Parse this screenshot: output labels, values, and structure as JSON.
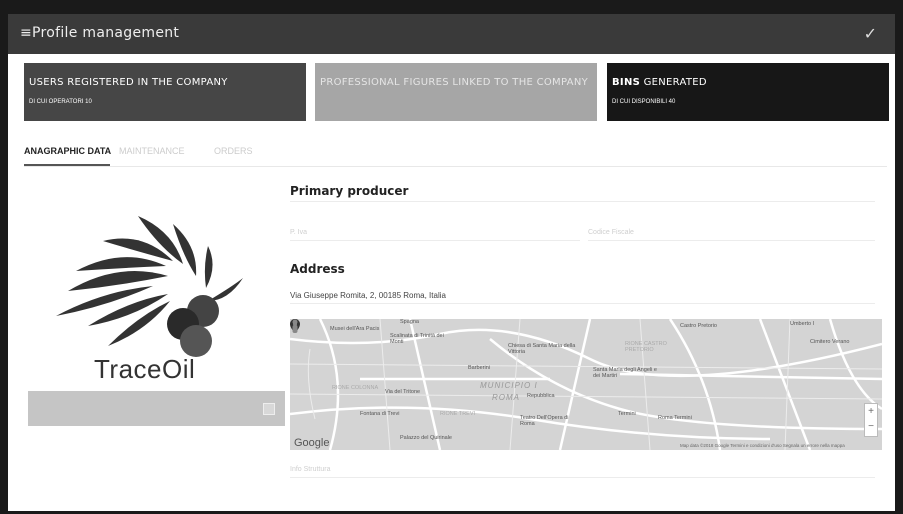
{
  "header": {
    "menu_icon": "≡",
    "title": "Profile management",
    "confirm_icon": "✓"
  },
  "cards": [
    {
      "title": "USERS REGISTERED IN THE COMPANY",
      "subtitle": "DI CUI OPERATORI 10"
    },
    {
      "title": "PROFESSIONAL FIGURES LINKED TO THE COMPANY",
      "subtitle": ""
    },
    {
      "title_bold": "BINS",
      "title_rest": " GENERATED",
      "subtitle": "DI CUI DISPONIBILI 40"
    }
  ],
  "tabs": [
    {
      "label": "ANAGRAPHIC DATA",
      "active": true
    },
    {
      "label": "MAINTENANCE",
      "active": false
    },
    {
      "label": "ORDERS",
      "active": false
    }
  ],
  "logo": {
    "text": "TraceOil"
  },
  "primary_producer": {
    "heading": "Primary producer",
    "vat_placeholder": "P. Iva",
    "fiscal_code_placeholder": "Codice Fiscale"
  },
  "address": {
    "heading": "Address",
    "value": "Via Giuseppe Romita, 2, 00185 Roma, Italia"
  },
  "map": {
    "labels": [
      "Musei dell'Ara Pacis",
      "Spagna",
      "Scalinata di Trinità dei Monti",
      "Chiesa di Santa Maria della Vittoria",
      "Castro Pretorio",
      "Santa Maria degli Angeli e dei Martiri",
      "Barberini",
      "Via del Tritone",
      "Repubblica",
      "Fontana di Trevi",
      "Teatro Dell'Opera di Roma",
      "Termini",
      "Roma Termini",
      "Palazzo del Quirinale",
      "Cimitero Verano",
      "Umberto I"
    ],
    "district_labels": [
      "MUNICIPIO I",
      "ROMA",
      "RIONE COLONNA",
      "RIONE TREVI",
      "RIONE CASTRO PRETORIO"
    ],
    "brand": "Google",
    "footer": "Map data ©2018 Google   Termini e condizioni d'uso   Segnala un errore nella mappa",
    "zoom_in": "+",
    "zoom_out": "−"
  },
  "extra_field_placeholder": "Info Struttura"
}
